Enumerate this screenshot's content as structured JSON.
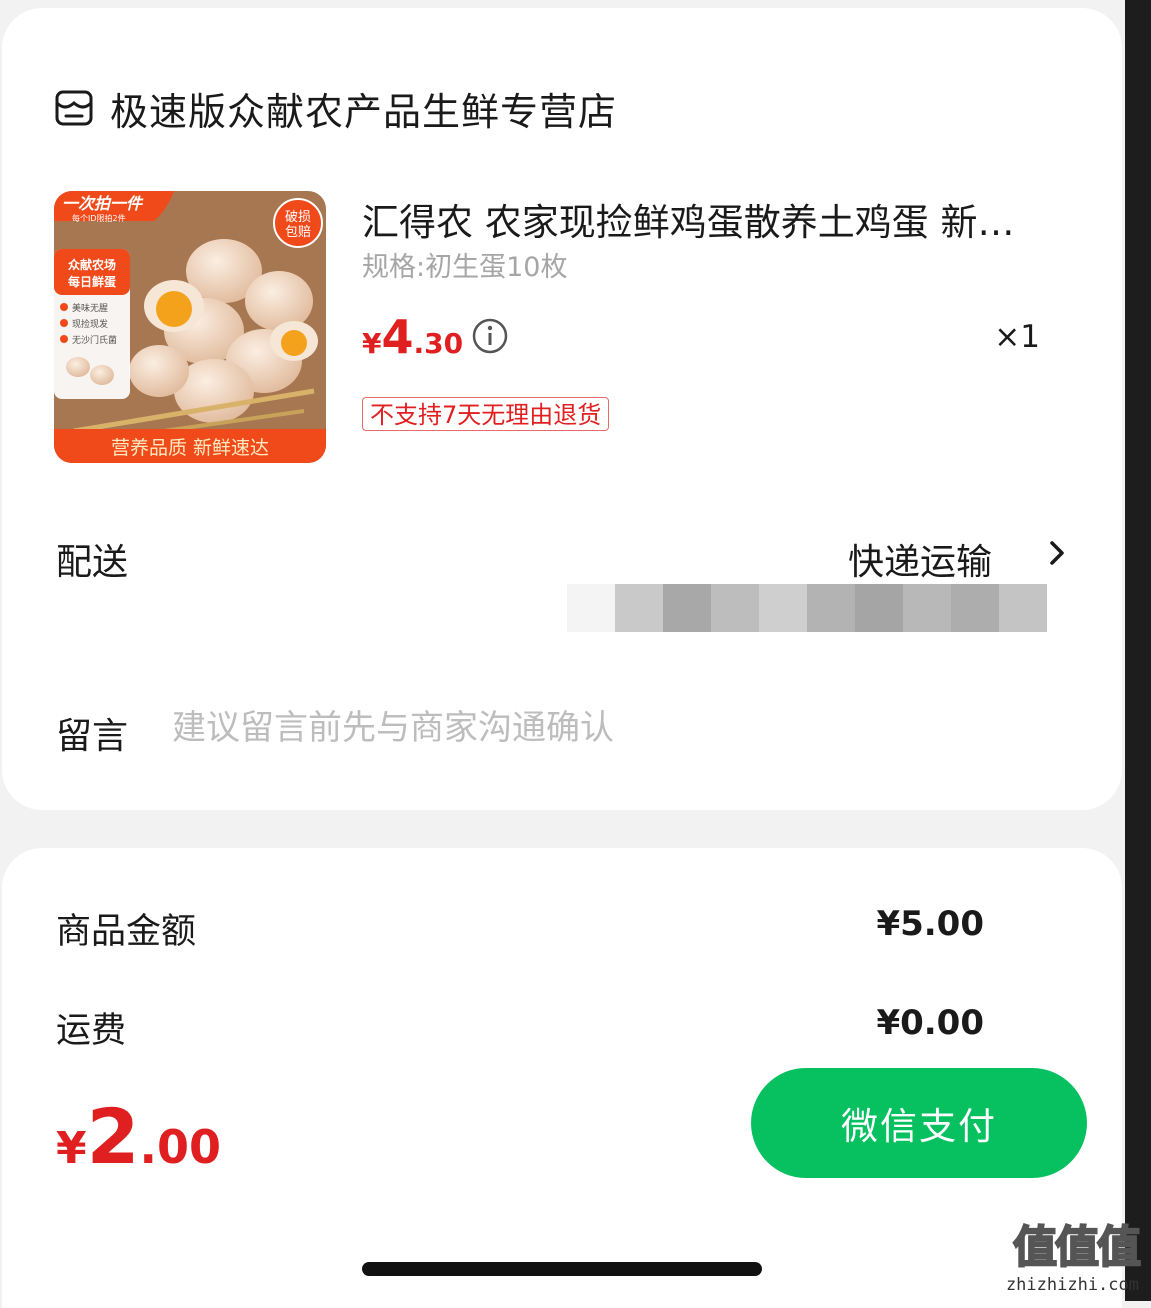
{
  "store": {
    "name": "极速版众献农产品生鲜专营店",
    "icon": "store-icon"
  },
  "product": {
    "title": "汇得农 农家现捡鲜鸡蛋散养土鸡蛋 新…",
    "spec": "规格:初生蛋10枚",
    "price_currency": "¥",
    "price_int": "4",
    "price_dec": ".30",
    "quantity": "×1",
    "return_tag": "不支持7天无理由退货",
    "image": {
      "banner_top": "一次拍一件",
      "banner_top_sub": "每个ID限拍2件",
      "badge": "破损包赔",
      "side_title": "众献农场 每日鲜蛋",
      "side_items": [
        "美味无腥",
        "现捡现发",
        "无沙门氏菌"
      ],
      "footer": "营养品质  新鲜速达"
    }
  },
  "delivery": {
    "label": "配送",
    "value": "快递运输"
  },
  "message": {
    "label": "留言",
    "placeholder": "建议留言前先与商家沟通确认"
  },
  "summary": {
    "goods_label": "商品金额",
    "goods_value": "¥5.00",
    "shipping_label": "运费",
    "shipping_value": "¥0.00"
  },
  "total": {
    "currency": "¥",
    "int": "2",
    "dec": ".00"
  },
  "pay_button": "微信支付",
  "watermark": {
    "big": "值值值",
    "small": "zhizhizhi.com"
  },
  "colors": {
    "price_red": "#e02020",
    "wechat_green": "#07c160"
  }
}
